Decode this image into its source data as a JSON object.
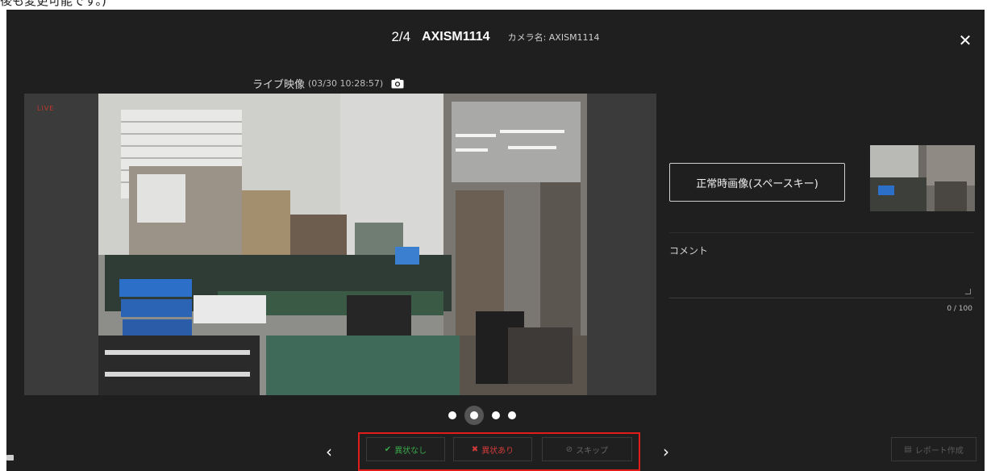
{
  "top_strip": {
    "text": "後も変更可能です。)"
  },
  "header": {
    "index": "2/4",
    "camera_id": "AXISM1114",
    "camera_name": "カメラ名: AXISM1114",
    "close_icon": "close-icon"
  },
  "live": {
    "label": "ライブ映像",
    "timestamp": "(03/30 10:28:57)",
    "icon": "camera-icon"
  },
  "video": {
    "overlay_tag": "LIVE"
  },
  "right_panel": {
    "normal_image_button": "正常時画像(スペースキー)",
    "comment_placeholder": "コメント",
    "comment_counter": "0 / 100"
  },
  "carousel": {
    "count": 4,
    "active_index": 1
  },
  "bottom_bar": {
    "prev_icon": "chevron-left-icon",
    "next_icon": "chevron-right-icon",
    "ok_label": "異状なし",
    "ng_label": "異状あり",
    "skip_label": "スキップ",
    "report_label": "レポート作成",
    "highlight_color": "#e21b1b"
  },
  "colors": {
    "modal_bg": "#1f1f1f",
    "ok": "#3aa64a",
    "ng": "#d23a3a"
  }
}
